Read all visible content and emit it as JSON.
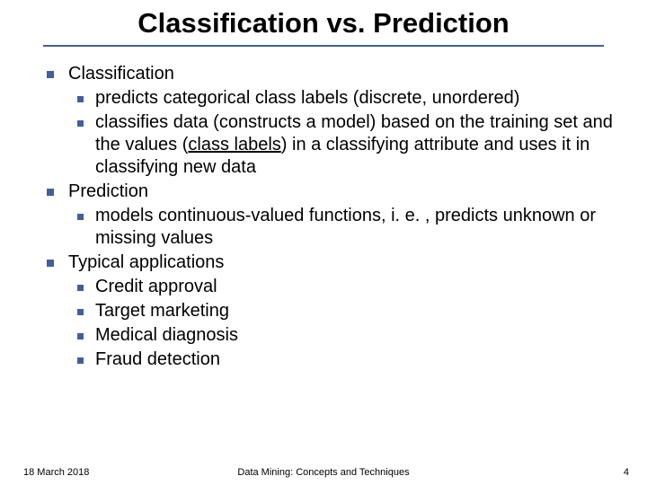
{
  "title": "Classification vs. Prediction",
  "items": [
    {
      "label": "Classification",
      "children": [
        {
          "text": "predicts categorical class labels (discrete, unordered)"
        },
        {
          "pre": "classifies data (constructs a model) based on the training set and the values (",
          "term": "class labels",
          "post": ") in a classifying attribute and uses it in classifying new data"
        }
      ]
    },
    {
      "label": "Prediction",
      "children": [
        {
          "text": "models continuous-valued functions, i. e. , predicts unknown or missing values"
        }
      ]
    },
    {
      "label": "Typical applications",
      "children": [
        {
          "text": "Credit approval"
        },
        {
          "text": "Target marketing"
        },
        {
          "text": "Medical diagnosis"
        },
        {
          "text": "Fraud detection"
        }
      ]
    }
  ],
  "footer": {
    "date": "18 March 2018",
    "center": "Data Mining: Concepts and Techniques",
    "page": "4"
  }
}
